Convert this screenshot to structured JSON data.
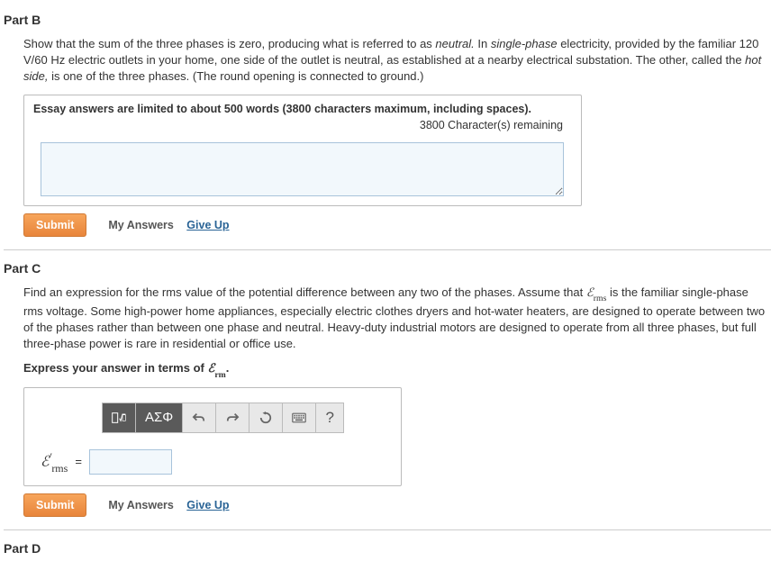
{
  "partB": {
    "header": "Part B",
    "prompt_1": "Show that the sum of the three phases is zero, producing what is referred to as ",
    "prompt_neutral": "neutral.",
    "prompt_2": " In ",
    "prompt_single": "single-phase",
    "prompt_3": " electricity, provided by the familiar 120 V/60 Hz electric outlets in your home, one side of the outlet is neutral, as established at a nearby electrical substation. The other, called the ",
    "prompt_hot": "hot side,",
    "prompt_4": " is one of the three phases. (The round opening is connected to ground.)",
    "essay_limit": "Essay answers are limited to about 500 words (3800 characters maximum, including spaces).",
    "remaining": "3800 Character(s) remaining",
    "textarea_value": ""
  },
  "partC": {
    "header": "Part C",
    "prompt_1": "Find an expression for the rms value of the potential difference between any two of the phases. Assume that ",
    "prompt_2": " is the familiar single-phase rms voltage. Some high-power home appliances, especially electric clothes dryers and hot-water heaters, are designed to operate between two of the phases rather than between one phase and neutral. Heavy-duty industrial motors are designed to operate from all three phases, but full three-phase power is rare in residential or office use.",
    "instruct": "Express your answer in terms of ",
    "period": ".",
    "var_E": "ℰ",
    "var_rms": "rms",
    "equals": " = ",
    "answer_value": "",
    "tool_greek": "ΑΣΦ",
    "tool_q": "?"
  },
  "partD": {
    "header": "Part D"
  },
  "actions": {
    "submit": "Submit",
    "my_answers": "My Answers",
    "give_up": "Give Up"
  }
}
